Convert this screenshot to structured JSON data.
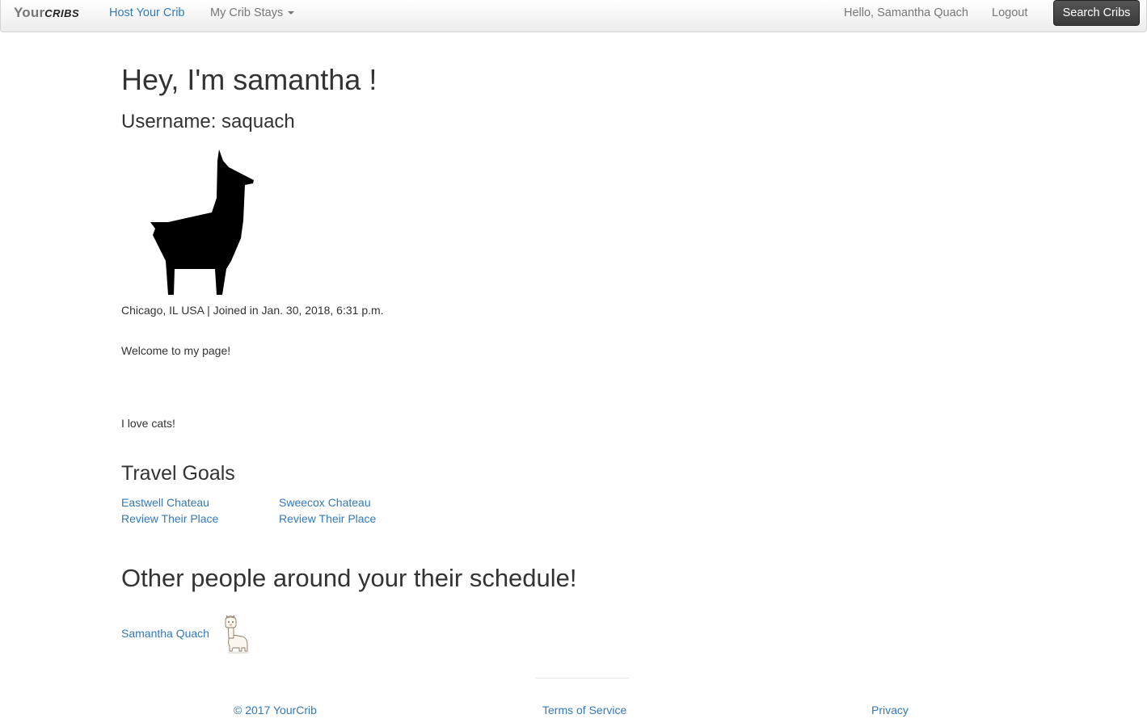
{
  "navbar": {
    "brand_prefix": "Your",
    "brand_suffix": "CRIBS",
    "host_link": "Host Your Crib",
    "stays_menu": "My Crib Stays",
    "greeting": "Hello, Samantha Quach",
    "logout": "Logout",
    "search_button": "Search Cribs"
  },
  "profile": {
    "heading": "Hey, I'm samantha !",
    "username_line": "Username: saquach",
    "avatar_icon": "llama-silhouette-icon",
    "meta_line": "Chicago, IL USA | Joined in Jan. 30, 2018, 6:31 p.m.",
    "bio_lines": [
      "Welcome to my page!",
      "I love cats!"
    ]
  },
  "travel_goals": {
    "heading": "Travel Goals",
    "items": [
      {
        "name": "Eastwell Chateau",
        "review_label": "Review Their Place"
      },
      {
        "name": "Sweecox Chateau",
        "review_label": "Review Their Place"
      }
    ]
  },
  "others": {
    "heading": "Other people around your their schedule!",
    "people": [
      {
        "name": "Samantha Quach",
        "avatar_icon": "alpaca-cartoon-icon"
      }
    ]
  },
  "footer": {
    "copyright": "© 2017 YourCrib",
    "terms": "Terms of Service",
    "privacy": "Privacy"
  },
  "colors": {
    "link": "#337ab7",
    "text": "#333333",
    "nav_text": "#777777",
    "button_bg": "#444444"
  }
}
